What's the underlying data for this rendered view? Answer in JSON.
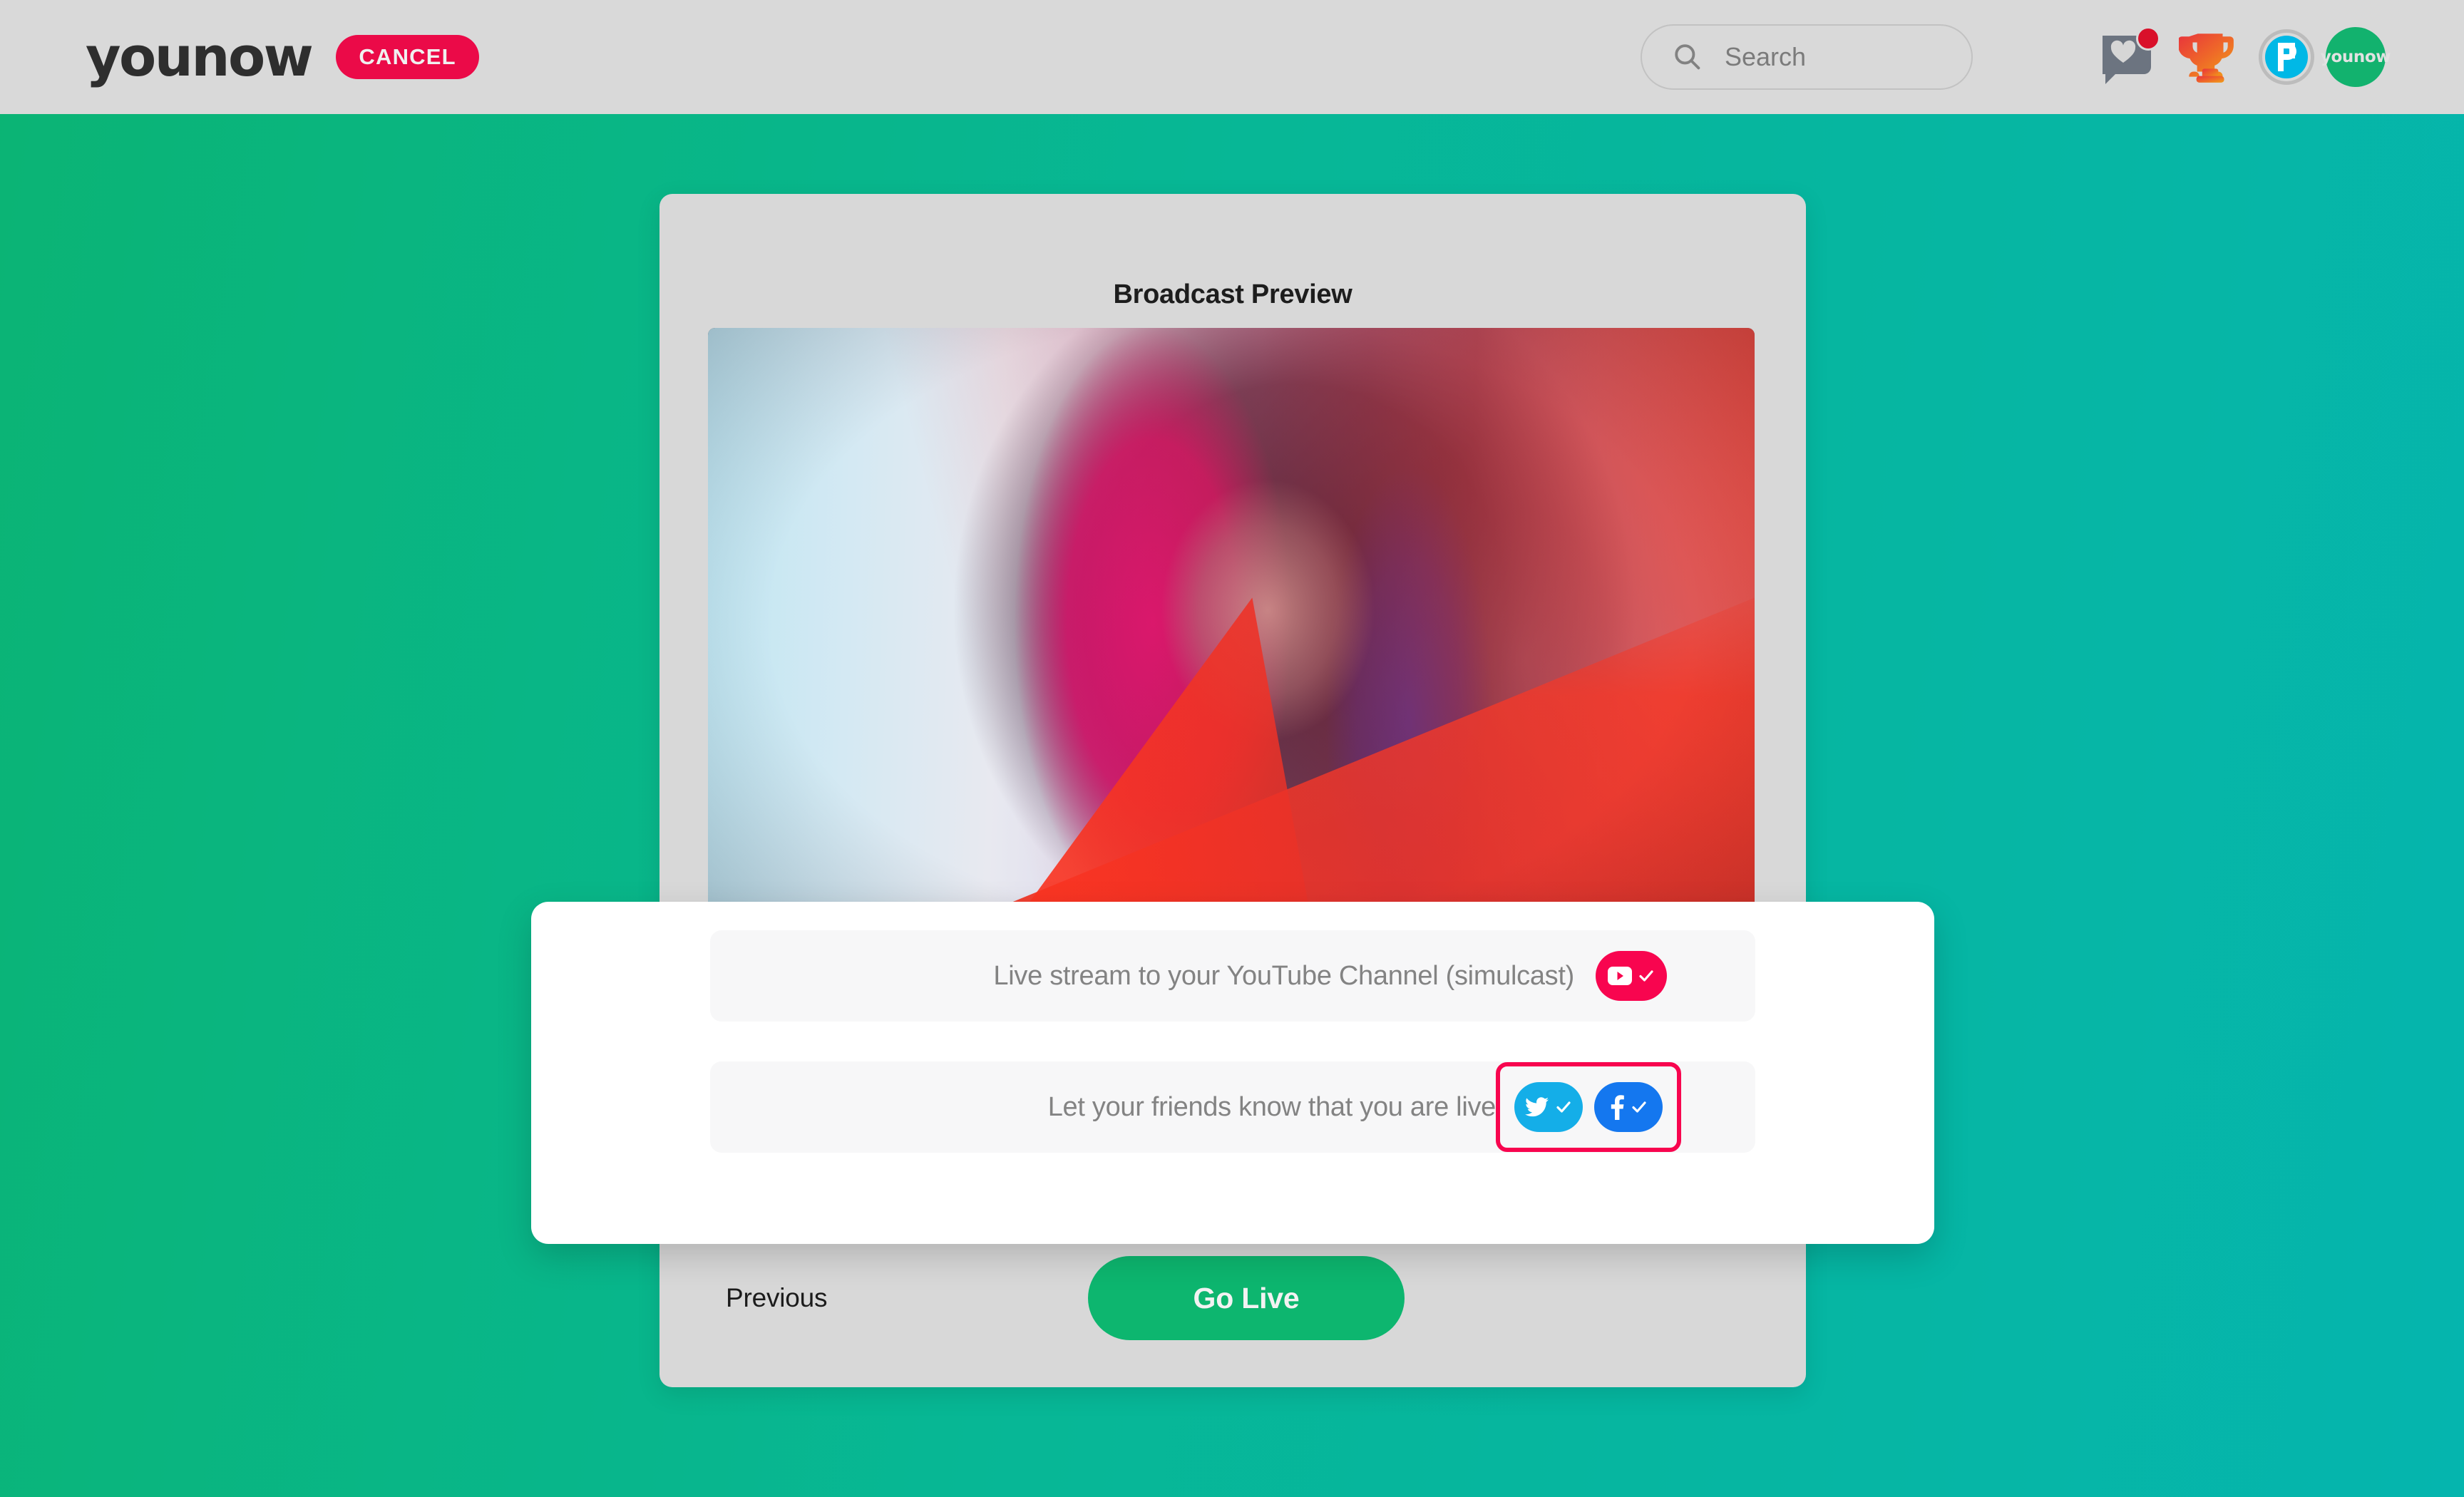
{
  "header": {
    "logo_text": "younow",
    "cancel_label": "CANCEL",
    "search": {
      "placeholder": "Search",
      "icon": "search-icon"
    },
    "icons": [
      {
        "name": "notifications-icon",
        "label": "",
        "has_badge": true
      },
      {
        "name": "trophy-icon",
        "label": ""
      },
      {
        "name": "props-icon",
        "label": ""
      }
    ],
    "avatar_label": "younow",
    "colors": {
      "bar_bg": "#d9d9d9",
      "cancel_bg": "#eb0a48",
      "badge": "#d9102a",
      "avatar_bg": "#12b26e"
    }
  },
  "card": {
    "title": "Broadcast Preview",
    "preview_alt": "broadcast-preview-video",
    "previous_label": "Previous",
    "go_live_label": "Go Live",
    "go_live_color": "#0db66f"
  },
  "modal": {
    "options": [
      {
        "id": "simulcast",
        "label": "Live stream to your YouTube Channel (simulcast)",
        "toggles": [
          {
            "name": "youtube-toggle",
            "platform": "YouTube",
            "enabled": true,
            "color": "#f8054f"
          }
        ],
        "highlighted": false
      },
      {
        "id": "social-share",
        "label": "Let your friends know that you are live",
        "toggles": [
          {
            "name": "twitter-toggle",
            "platform": "Twitter",
            "enabled": true,
            "color": "#14aee8"
          },
          {
            "name": "facebook-toggle",
            "platform": "Facebook",
            "enabled": true,
            "color": "#1477ef"
          }
        ],
        "highlighted": true,
        "highlight_color": "#f8054f"
      }
    ]
  },
  "background": {
    "gradient_from": "#0bb474",
    "gradient_to": "#05b5ae"
  }
}
